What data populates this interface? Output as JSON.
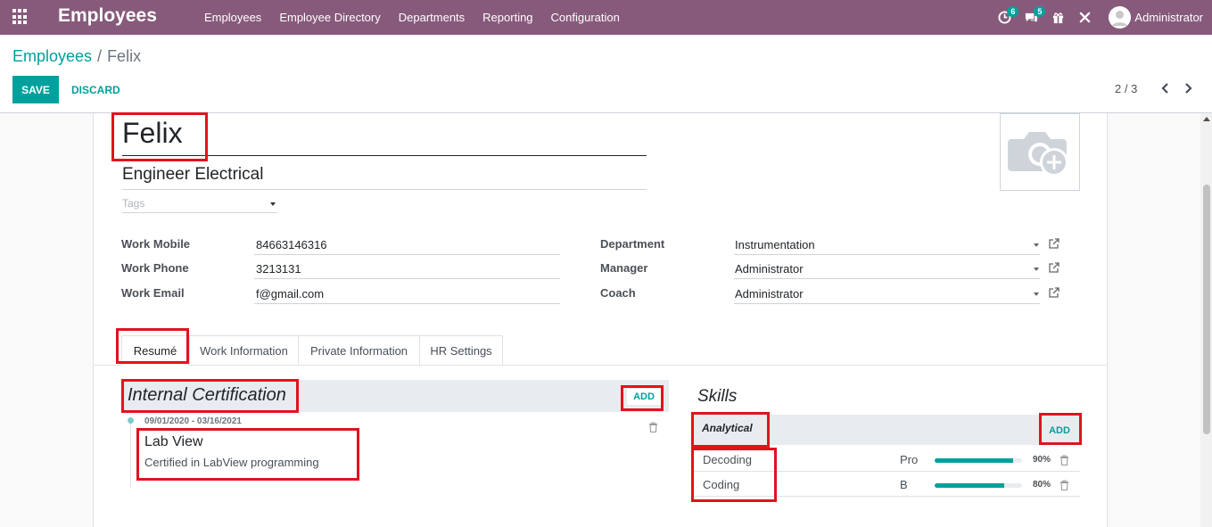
{
  "navbar": {
    "brand": "Employees",
    "menu": [
      "Employees",
      "Employee Directory",
      "Departments",
      "Reporting",
      "Configuration"
    ],
    "activity_count": "6",
    "message_count": "5",
    "user": "Administrator",
    "bg_color": "#875a7b"
  },
  "control_panel": {
    "breadcrumb_root": "Employees",
    "breadcrumb_sep": "/",
    "breadcrumb_current": "Felix",
    "save_label": "SAVE",
    "discard_label": "DISCARD",
    "pager": "2 / 3"
  },
  "employee": {
    "name": "Felix",
    "job_title": "Engineer Electrical",
    "tags_placeholder": "Tags",
    "work_mobile_label": "Work Mobile",
    "work_mobile": "84663146316",
    "work_phone_label": "Work Phone",
    "work_phone": "3213131",
    "work_email_label": "Work Email",
    "work_email": "f@gmail.com",
    "department_label": "Department",
    "department": "Instrumentation",
    "manager_label": "Manager",
    "manager": "Administrator",
    "coach_label": "Coach",
    "coach": "Administrator"
  },
  "tabs": [
    "Resumé",
    "Work Information",
    "Private Information",
    "HR Settings"
  ],
  "resume": {
    "section_title": "Internal Certification",
    "add_label": "ADD",
    "entry": {
      "dates": "09/01/2020 - 03/16/2021",
      "name": "Lab View",
      "description": "Certified in LabView programming"
    }
  },
  "skills": {
    "title": "Skills",
    "type": "Analytical",
    "add_label": "ADD",
    "rows": [
      {
        "name": "Decoding",
        "level": "Pro",
        "progress": 90,
        "progress_label": "90%"
      },
      {
        "name": "Coding",
        "level": "B",
        "progress": 80,
        "progress_label": "80%"
      }
    ]
  },
  "accent_color": "#00a09d",
  "highlight_color": "#e0131d"
}
